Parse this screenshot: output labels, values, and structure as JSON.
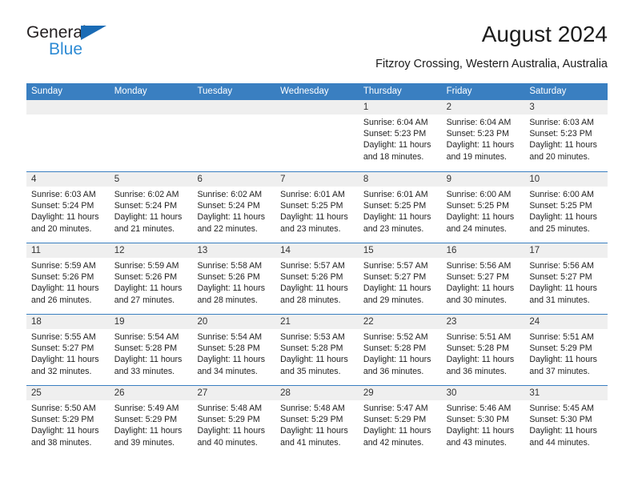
{
  "brand": {
    "line1": "General",
    "line2": "Blue",
    "triangle_color": "#1a6bb5",
    "blue_color": "#2e8bd4"
  },
  "header": {
    "title": "August 2024",
    "subtitle": "Fitzroy Crossing, Western Australia, Australia"
  },
  "theme": {
    "header_blue": "#3a7fc1",
    "daynum_band": "#efefef",
    "text": "#1f1f1f"
  },
  "weekdays": [
    "Sunday",
    "Monday",
    "Tuesday",
    "Wednesday",
    "Thursday",
    "Friday",
    "Saturday"
  ],
  "weeks": [
    [
      {
        "day": "",
        "lines": []
      },
      {
        "day": "",
        "lines": []
      },
      {
        "day": "",
        "lines": []
      },
      {
        "day": "",
        "lines": []
      },
      {
        "day": "1",
        "lines": [
          "Sunrise: 6:04 AM",
          "Sunset: 5:23 PM",
          "Daylight: 11 hours",
          "and 18 minutes."
        ]
      },
      {
        "day": "2",
        "lines": [
          "Sunrise: 6:04 AM",
          "Sunset: 5:23 PM",
          "Daylight: 11 hours",
          "and 19 minutes."
        ]
      },
      {
        "day": "3",
        "lines": [
          "Sunrise: 6:03 AM",
          "Sunset: 5:23 PM",
          "Daylight: 11 hours",
          "and 20 minutes."
        ]
      }
    ],
    [
      {
        "day": "4",
        "lines": [
          "Sunrise: 6:03 AM",
          "Sunset: 5:24 PM",
          "Daylight: 11 hours",
          "and 20 minutes."
        ]
      },
      {
        "day": "5",
        "lines": [
          "Sunrise: 6:02 AM",
          "Sunset: 5:24 PM",
          "Daylight: 11 hours",
          "and 21 minutes."
        ]
      },
      {
        "day": "6",
        "lines": [
          "Sunrise: 6:02 AM",
          "Sunset: 5:24 PM",
          "Daylight: 11 hours",
          "and 22 minutes."
        ]
      },
      {
        "day": "7",
        "lines": [
          "Sunrise: 6:01 AM",
          "Sunset: 5:25 PM",
          "Daylight: 11 hours",
          "and 23 minutes."
        ]
      },
      {
        "day": "8",
        "lines": [
          "Sunrise: 6:01 AM",
          "Sunset: 5:25 PM",
          "Daylight: 11 hours",
          "and 23 minutes."
        ]
      },
      {
        "day": "9",
        "lines": [
          "Sunrise: 6:00 AM",
          "Sunset: 5:25 PM",
          "Daylight: 11 hours",
          "and 24 minutes."
        ]
      },
      {
        "day": "10",
        "lines": [
          "Sunrise: 6:00 AM",
          "Sunset: 5:25 PM",
          "Daylight: 11 hours",
          "and 25 minutes."
        ]
      }
    ],
    [
      {
        "day": "11",
        "lines": [
          "Sunrise: 5:59 AM",
          "Sunset: 5:26 PM",
          "Daylight: 11 hours",
          "and 26 minutes."
        ]
      },
      {
        "day": "12",
        "lines": [
          "Sunrise: 5:59 AM",
          "Sunset: 5:26 PM",
          "Daylight: 11 hours",
          "and 27 minutes."
        ]
      },
      {
        "day": "13",
        "lines": [
          "Sunrise: 5:58 AM",
          "Sunset: 5:26 PM",
          "Daylight: 11 hours",
          "and 28 minutes."
        ]
      },
      {
        "day": "14",
        "lines": [
          "Sunrise: 5:57 AM",
          "Sunset: 5:26 PM",
          "Daylight: 11 hours",
          "and 28 minutes."
        ]
      },
      {
        "day": "15",
        "lines": [
          "Sunrise: 5:57 AM",
          "Sunset: 5:27 PM",
          "Daylight: 11 hours",
          "and 29 minutes."
        ]
      },
      {
        "day": "16",
        "lines": [
          "Sunrise: 5:56 AM",
          "Sunset: 5:27 PM",
          "Daylight: 11 hours",
          "and 30 minutes."
        ]
      },
      {
        "day": "17",
        "lines": [
          "Sunrise: 5:56 AM",
          "Sunset: 5:27 PM",
          "Daylight: 11 hours",
          "and 31 minutes."
        ]
      }
    ],
    [
      {
        "day": "18",
        "lines": [
          "Sunrise: 5:55 AM",
          "Sunset: 5:27 PM",
          "Daylight: 11 hours",
          "and 32 minutes."
        ]
      },
      {
        "day": "19",
        "lines": [
          "Sunrise: 5:54 AM",
          "Sunset: 5:28 PM",
          "Daylight: 11 hours",
          "and 33 minutes."
        ]
      },
      {
        "day": "20",
        "lines": [
          "Sunrise: 5:54 AM",
          "Sunset: 5:28 PM",
          "Daylight: 11 hours",
          "and 34 minutes."
        ]
      },
      {
        "day": "21",
        "lines": [
          "Sunrise: 5:53 AM",
          "Sunset: 5:28 PM",
          "Daylight: 11 hours",
          "and 35 minutes."
        ]
      },
      {
        "day": "22",
        "lines": [
          "Sunrise: 5:52 AM",
          "Sunset: 5:28 PM",
          "Daylight: 11 hours",
          "and 36 minutes."
        ]
      },
      {
        "day": "23",
        "lines": [
          "Sunrise: 5:51 AM",
          "Sunset: 5:28 PM",
          "Daylight: 11 hours",
          "and 36 minutes."
        ]
      },
      {
        "day": "24",
        "lines": [
          "Sunrise: 5:51 AM",
          "Sunset: 5:29 PM",
          "Daylight: 11 hours",
          "and 37 minutes."
        ]
      }
    ],
    [
      {
        "day": "25",
        "lines": [
          "Sunrise: 5:50 AM",
          "Sunset: 5:29 PM",
          "Daylight: 11 hours",
          "and 38 minutes."
        ]
      },
      {
        "day": "26",
        "lines": [
          "Sunrise: 5:49 AM",
          "Sunset: 5:29 PM",
          "Daylight: 11 hours",
          "and 39 minutes."
        ]
      },
      {
        "day": "27",
        "lines": [
          "Sunrise: 5:48 AM",
          "Sunset: 5:29 PM",
          "Daylight: 11 hours",
          "and 40 minutes."
        ]
      },
      {
        "day": "28",
        "lines": [
          "Sunrise: 5:48 AM",
          "Sunset: 5:29 PM",
          "Daylight: 11 hours",
          "and 41 minutes."
        ]
      },
      {
        "day": "29",
        "lines": [
          "Sunrise: 5:47 AM",
          "Sunset: 5:29 PM",
          "Daylight: 11 hours",
          "and 42 minutes."
        ]
      },
      {
        "day": "30",
        "lines": [
          "Sunrise: 5:46 AM",
          "Sunset: 5:30 PM",
          "Daylight: 11 hours",
          "and 43 minutes."
        ]
      },
      {
        "day": "31",
        "lines": [
          "Sunrise: 5:45 AM",
          "Sunset: 5:30 PM",
          "Daylight: 11 hours",
          "and 44 minutes."
        ]
      }
    ]
  ]
}
